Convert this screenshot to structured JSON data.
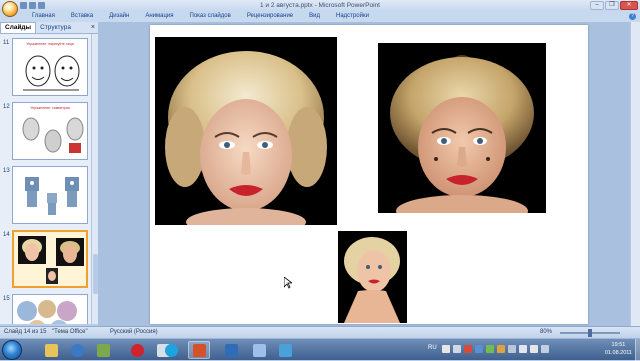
{
  "window": {
    "title": "1 и 2 августа.pptx - Microsoft PowerPoint",
    "minimize": "–",
    "maximize": "❐",
    "close": "✕"
  },
  "ribbon": {
    "tabs": [
      "Главная",
      "Вставка",
      "Дизайн",
      "Анимация",
      "Показ слайдов",
      "Рецензирование",
      "Вид",
      "Надстройки"
    ],
    "help": "?"
  },
  "slides_panel": {
    "tabs": [
      "Слайды",
      "Структура"
    ],
    "active_tab": "Слайды",
    "close": "×",
    "thumbnails": [
      {
        "number": "11",
        "title": "Упражнение: нарисуйте лица"
      },
      {
        "number": "12",
        "title": "Упражнение: симметрия"
      },
      {
        "number": "13",
        "title": ""
      },
      {
        "number": "14",
        "title": ""
      },
      {
        "number": "15",
        "title": ""
      }
    ],
    "selected": "14"
  },
  "statusbar": {
    "slide_info": "Слайд 14 из 15",
    "theme": "\"Тема Office\"",
    "language": "Русский (Россия)",
    "zoom": "80%"
  },
  "taskbar": {
    "lang": "RU",
    "time": "19:51",
    "date": "01.08.2011",
    "apps": [
      "explorer",
      "media-player",
      "photos",
      "opera",
      "files",
      "skype",
      "powerpoint",
      "aero",
      "text-editor",
      "network-monitor"
    ],
    "active_app": "powerpoint"
  },
  "colors": {
    "accent": "#15428b",
    "selection": "#f0a030",
    "title_red": "#c0262d"
  }
}
